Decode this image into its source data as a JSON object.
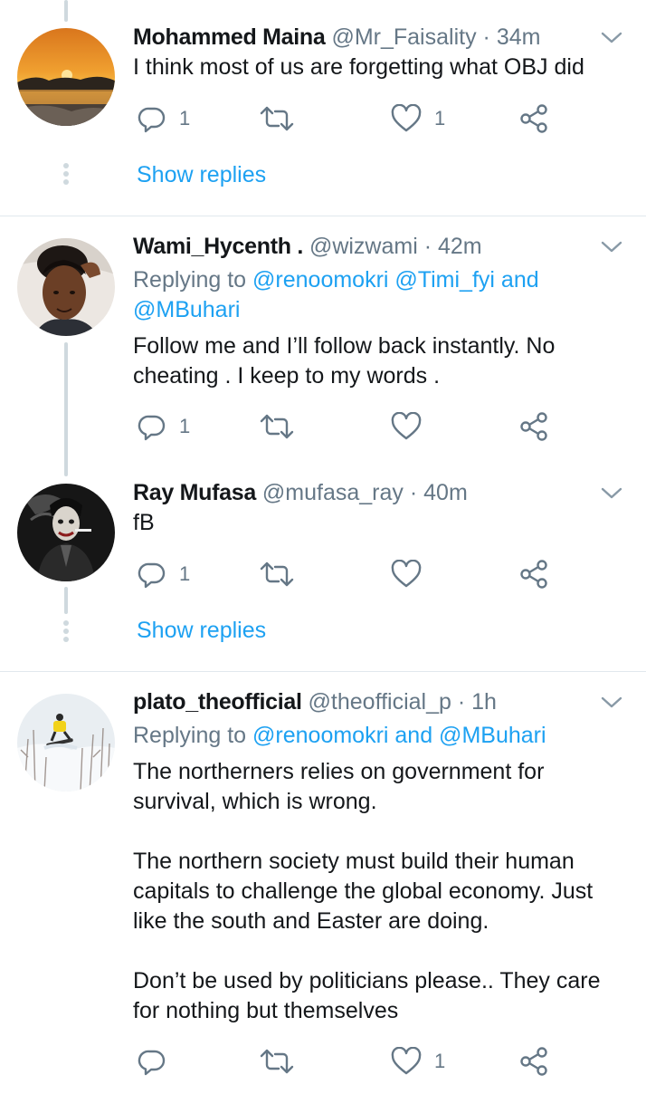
{
  "colors": {
    "accent": "#1da1f2",
    "secondary_text": "#657786",
    "primary_text": "#14171a",
    "thread_line": "#cfd9de",
    "divider": "#e1e8ed"
  },
  "tweets": [
    {
      "name": "Mohammed Maina",
      "handle": "@Mr_Faisality",
      "separator": "·",
      "time": "34m",
      "replying_prefix": "",
      "replying_to": "",
      "text_lines": [
        "I think most of us are forgetting what OBJ did"
      ],
      "reply_count": "1",
      "retweet_count": "",
      "like_count": "1",
      "avatar_icon": "sunset-avatar"
    },
    {
      "name": "Wami_Hycenth .",
      "handle": "@wizwami",
      "separator": "·",
      "time": "42m",
      "replying_prefix": "Replying to ",
      "replying_to_line1": "@renoomokri @Timi_fyi and",
      "replying_to_line2": "@MBuhari",
      "text_lines": [
        "Follow me and I’ll follow back instantly. No",
        "cheating . I keep to my words ."
      ],
      "reply_count": "1",
      "retweet_count": "",
      "like_count": "",
      "avatar_icon": "person-avatar"
    },
    {
      "name": "Ray Mufasa",
      "handle": "@mufasa_ray",
      "separator": "·",
      "time": "40m",
      "text_lines": [
        "fB"
      ],
      "reply_count": "1",
      "retweet_count": "",
      "like_count": "",
      "avatar_icon": "joker-avatar"
    },
    {
      "name": "plato_theofficial",
      "handle": "@theofficial_p",
      "separator": "·",
      "time": "1h",
      "replying_prefix": "Replying to ",
      "replying_to": "@renoomokri and @MBuhari",
      "text_lines": [
        "The northerners relies on government for",
        "survival, which is wrong.",
        "",
        "The northern society must build their human",
        "capitals to challenge the global economy. Just",
        "like the south and Easter are doing.",
        "",
        "Don’t be used by politicians please.. They care",
        "for nothing but themselves"
      ],
      "reply_count": "",
      "retweet_count": "",
      "like_count": "1",
      "avatar_icon": "snowboarder-avatar"
    }
  ],
  "show_replies_label": "Show replies"
}
